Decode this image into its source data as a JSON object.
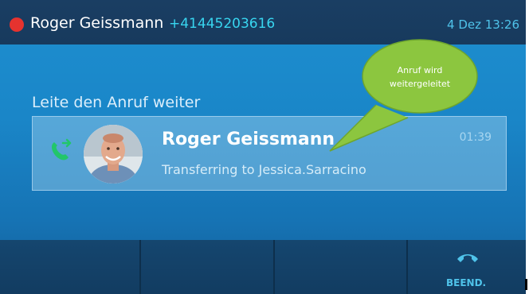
{
  "status_bar": {
    "caller_name": "Roger Geissmann",
    "caller_number": "+41445203616",
    "datetime": "4 Dez 13:26"
  },
  "call_state_heading": "Leite den Anruf weiter",
  "active_call": {
    "contact_name": "Roger Geissmann",
    "status": "Transferring to Jessica.Sarracino",
    "timer": "01:39",
    "icon": "phone-transfer-icon"
  },
  "annotation": {
    "line1": "Anruf wird",
    "line2": "weitergeleitet",
    "color": "#8cc63f"
  },
  "softkeys": {
    "end_call_label": "BEEND.",
    "end_call_icon": "hang-up-icon"
  },
  "colors": {
    "accent": "#4fc3ea",
    "record_dot": "#e5332f",
    "phone_icon": "#22c66a"
  }
}
